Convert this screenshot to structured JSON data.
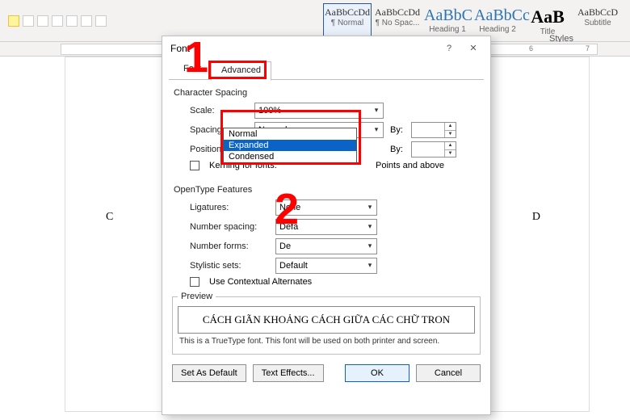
{
  "ribbon": {
    "styles": [
      {
        "sample": "AaBbCcDd",
        "label": "¶ Normal"
      },
      {
        "sample": "AaBbCcDd",
        "label": "¶ No Spac..."
      },
      {
        "sample": "AaBbC",
        "label": "Heading 1"
      },
      {
        "sample": "AaBbCc",
        "label": "Heading 2"
      },
      {
        "sample": "AaB",
        "label": "Title"
      },
      {
        "sample": "AaBbCcD",
        "label": "Subtitle"
      }
    ],
    "styles_section": "Styles"
  },
  "ruler": {
    "ticks": [
      "6",
      "7"
    ]
  },
  "docBehind": {
    "left": "C",
    "right": "D"
  },
  "dialog": {
    "title": "Font",
    "help": "?",
    "close": "✕",
    "tabs": {
      "font": "Font",
      "advanced": "Advanced"
    },
    "char_spacing": {
      "group": "Character Spacing",
      "scale_label": "Scale:",
      "scale_value": "100%",
      "spacing_label": "Spacing:",
      "spacing_value": "Normal",
      "spacing_options": [
        "Normal",
        "Expanded",
        "Condensed"
      ],
      "position_label": "Position:",
      "by_label": "By:",
      "kerning_label": "Kerning for fonts:",
      "pts_label": "Points and above"
    },
    "opentype": {
      "group": "OpenType Features",
      "ligatures_label": "Ligatures:",
      "ligatures_value": "None",
      "numspacing_label": "Number spacing:",
      "numspacing_value": "Defa",
      "numforms_label": "Number forms:",
      "numforms_value": "De",
      "stylistic_label": "Stylistic sets:",
      "stylistic_value": "Default",
      "contextual_label": "Use Contextual Alternates"
    },
    "preview": {
      "legend": "Preview",
      "text": "CÁCH GIÃN KHOẢNG CÁCH GIỮA CÁC CHỮ TRON",
      "hint": "This is a TrueType font. This font will be used on both printer and screen."
    },
    "buttons": {
      "default": "Set As Default",
      "effects": "Text Effects...",
      "ok": "OK",
      "cancel": "Cancel"
    }
  },
  "annotations": {
    "one": "1",
    "two": "2"
  }
}
